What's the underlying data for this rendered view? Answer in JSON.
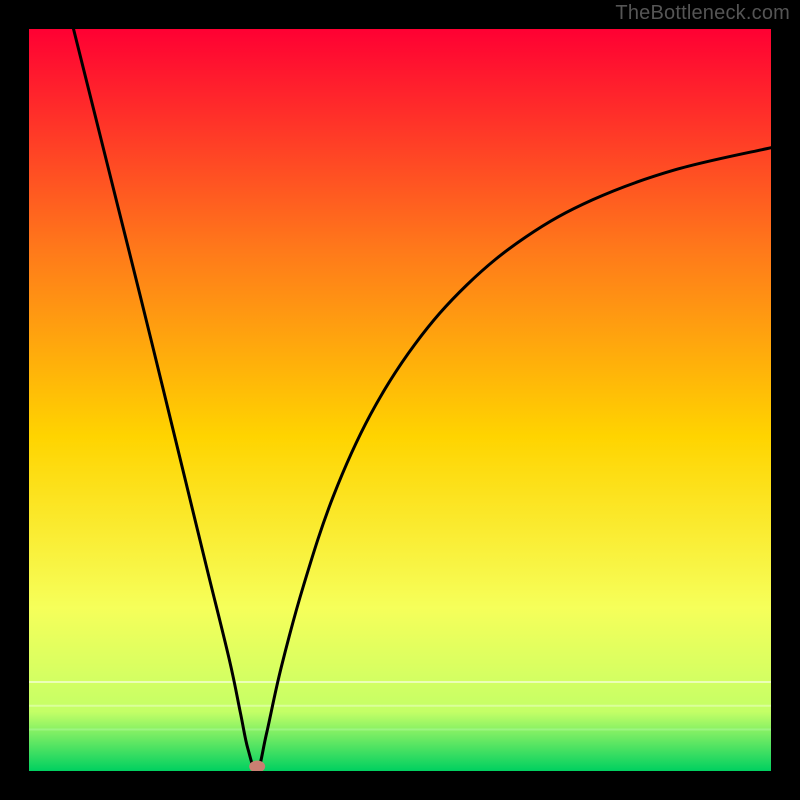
{
  "watermark": "TheBottleneck.com",
  "chart_data": {
    "type": "line",
    "title": "",
    "xlabel": "",
    "ylabel": "",
    "xlim": [
      0,
      1
    ],
    "ylim": [
      0,
      1
    ],
    "gradient_colors": {
      "top": "#ff0033",
      "upper_mid": "#ff7a1a",
      "mid": "#ffd400",
      "lower_mid": "#f6ff5a",
      "near_bottom": "#c4ff66",
      "bottom": "#00d060"
    },
    "series": [
      {
        "name": "curve",
        "x": [
          0.06,
          0.09,
          0.12,
          0.15,
          0.18,
          0.21,
          0.24,
          0.27,
          0.285,
          0.295,
          0.3075,
          0.32,
          0.34,
          0.37,
          0.41,
          0.46,
          0.52,
          0.59,
          0.67,
          0.76,
          0.87,
          1.0
        ],
        "y": [
          1.0,
          0.88,
          0.76,
          0.64,
          0.518,
          0.395,
          0.272,
          0.15,
          0.078,
          0.03,
          0.0,
          0.05,
          0.14,
          0.25,
          0.37,
          0.48,
          0.575,
          0.655,
          0.72,
          0.77,
          0.81,
          0.84
        ]
      }
    ],
    "marker": {
      "x": 0.3075,
      "y": 0.006,
      "color": "#c97f72"
    },
    "gridlines": [
      {
        "y": 0.12,
        "color": "rgba(255,255,255,0.55)"
      },
      {
        "y": 0.088,
        "color": "rgba(255,255,255,0.35)"
      },
      {
        "y": 0.056,
        "color": "rgba(200,255,200,0.3)"
      }
    ]
  }
}
